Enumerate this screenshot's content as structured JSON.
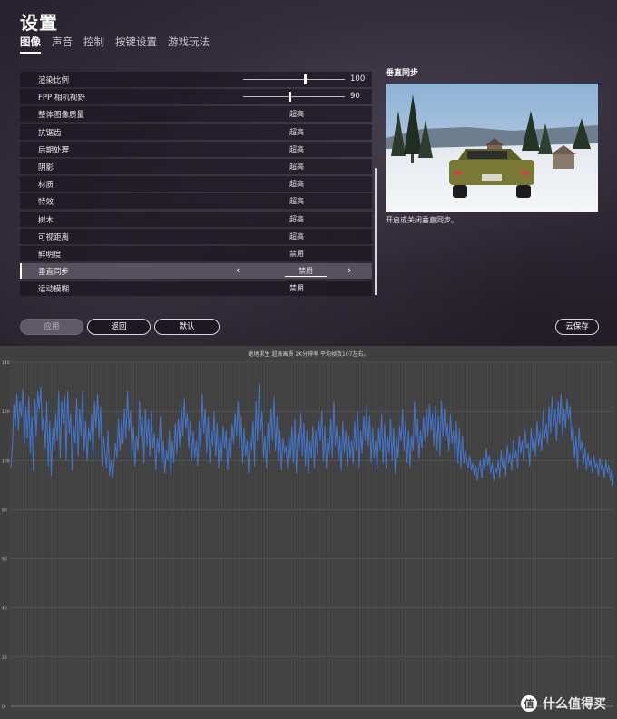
{
  "header": {
    "title": "设置"
  },
  "tabs": [
    {
      "label": "图像",
      "active": true
    },
    {
      "label": "声音",
      "active": false
    },
    {
      "label": "控制",
      "active": false
    },
    {
      "label": "按键设置",
      "active": false
    },
    {
      "label": "游戏玩法",
      "active": false
    }
  ],
  "settings": [
    {
      "label": "渲染比例",
      "type": "slider",
      "value": "100",
      "level": 0.6
    },
    {
      "label": "FPP 相机视野",
      "type": "slider",
      "value": "90",
      "level": 0.45
    },
    {
      "label": "整体图像质量",
      "value": "超高"
    },
    {
      "label": "抗锯齿",
      "value": "超高"
    },
    {
      "label": "后期处理",
      "value": "超高"
    },
    {
      "label": "阴影",
      "value": "超高"
    },
    {
      "label": "材质",
      "value": "超高"
    },
    {
      "label": "特效",
      "value": "超高"
    },
    {
      "label": "树木",
      "value": "超高"
    },
    {
      "label": "可视距离",
      "value": "超高"
    },
    {
      "label": "鲜明度",
      "value": "禁用"
    },
    {
      "label": "垂直同步",
      "value": "禁用",
      "selected": true
    },
    {
      "label": "运动模糊",
      "value": "禁用"
    }
  ],
  "preview": {
    "title": "垂直同步",
    "description": "开启或关闭垂直同步。"
  },
  "buttons": {
    "apply": "应用",
    "back": "返回",
    "default": "默认",
    "cloud_save": "云保存"
  },
  "chart_title": "绝地求生 超高画质 2K分辨率 平均帧数107左右。",
  "watermark": {
    "text": "什么值得买",
    "logo": "值"
  },
  "chart_data": {
    "type": "line",
    "title": "绝地求生 超高画质 2K分辨率 平均帧数107左右。",
    "ylim": [
      0,
      140
    ],
    "yticks": [
      0,
      20,
      40,
      60,
      80,
      100,
      120,
      140
    ],
    "grid": true,
    "series_color": "#4472c4",
    "series": [
      {
        "values": [
          97,
          106,
          123,
          114,
          127,
          112,
          124,
          118,
          129,
          107,
          122,
          109,
          126,
          103,
          118,
          96,
          125,
          110,
          128,
          121,
          130,
          112,
          118,
          105,
          124,
          98,
          116,
          94,
          113,
          104,
          119,
          108,
          128,
          101,
          124,
          115,
          126,
          100,
          128,
          111,
          119,
          96,
          114,
          107,
          125,
          102,
          121,
          110,
          128,
          104,
          116,
          100,
          113,
          108,
          119,
          101,
          124,
          113,
          127,
          109,
          122,
          98,
          110,
          103,
          97,
          112,
          94,
          100,
          93,
          99,
          107,
          101,
          117,
          104,
          116,
          107,
          121,
          109,
          128,
          112,
          120,
          101,
          114,
          98,
          110,
          104,
          124,
          110,
          118,
          99,
          121,
          106,
          117,
          102,
          120,
          105,
          111,
          96,
          109,
          103,
          118,
          97,
          108,
          95,
          104,
          100,
          112,
          94,
          108,
          99,
          115,
          103,
          117,
          106,
          122,
          110,
          125,
          113,
          119,
          105,
          116,
          100,
          112,
          101,
          108,
          98,
          116,
          104,
          127,
          111,
          121,
          103,
          118,
          99,
          112,
          106,
          120,
          102,
          115,
          97,
          110,
          100,
          114,
          105,
          112,
          96,
          109,
          101,
          115,
          107,
          119,
          110,
          124,
          105,
          118,
          99,
          113,
          102,
          108,
          95,
          110,
          104,
          116,
          98,
          124,
          108,
          131,
          112,
          120,
          101,
          110,
          97,
          115,
          103,
          121,
          108,
          126,
          104,
          118,
          100,
          112,
          96,
          109,
          103,
          106,
          97,
          110,
          101,
          114,
          99,
          117,
          95,
          111,
          104,
          119,
          102,
          115,
          98,
          112,
          95,
          108,
          101,
          114,
          97,
          112,
          103,
          116,
          108,
          120,
          100,
          114,
          97,
          109,
          103,
          117,
          101,
          124,
          106,
          114,
          100,
          110,
          96,
          116,
          103,
          112,
          98,
          110,
          101,
          108,
          99,
          116,
          104,
          120,
          97,
          112,
          103,
          118,
          108,
          122,
          106,
          118,
          99,
          113,
          101,
          108,
          96,
          113,
          104,
          119,
          99,
          115,
          97,
          110,
          103,
          117,
          100,
          113,
          95,
          110,
          101,
          114,
          108,
          121,
          104,
          116,
          99,
          112,
          97,
          110,
          104,
          124,
          107,
          117,
          101,
          112,
          105,
          118,
          108,
          121,
          110,
          123,
          112,
          119,
          106,
          122,
          104,
          118,
          102,
          124,
          110,
          121,
          108,
          115,
          104,
          119,
          107,
          112,
          101,
          116,
          99,
          113,
          97,
          110,
          99,
          104,
          100,
          97,
          102,
          96,
          99,
          94,
          98,
          92,
          97,
          100,
          93,
          101,
          96,
          105,
          98,
          102,
          95,
          99,
          92,
          97,
          95,
          100,
          93,
          104,
          97,
          101,
          94,
          106,
          99,
          103,
          96,
          108,
          101,
          104,
          97,
          110,
          103,
          108,
          100,
          112,
          105,
          107,
          98,
          113,
          104,
          110,
          102,
          116,
          106,
          112,
          104,
          120,
          109,
          115,
          107,
          122,
          111,
          126,
          114,
          121,
          108,
          124,
          115,
          127,
          110,
          121,
          113,
          125,
          117,
          122,
          108,
          115,
          101,
          110,
          97,
          113,
          104,
          108,
          99,
          105,
          96,
          103,
          98,
          100,
          95,
          102,
          97,
          99,
          94,
          101,
          96,
          98,
          93,
          100,
          95,
          98,
          92,
          96,
          90
        ]
      }
    ]
  }
}
